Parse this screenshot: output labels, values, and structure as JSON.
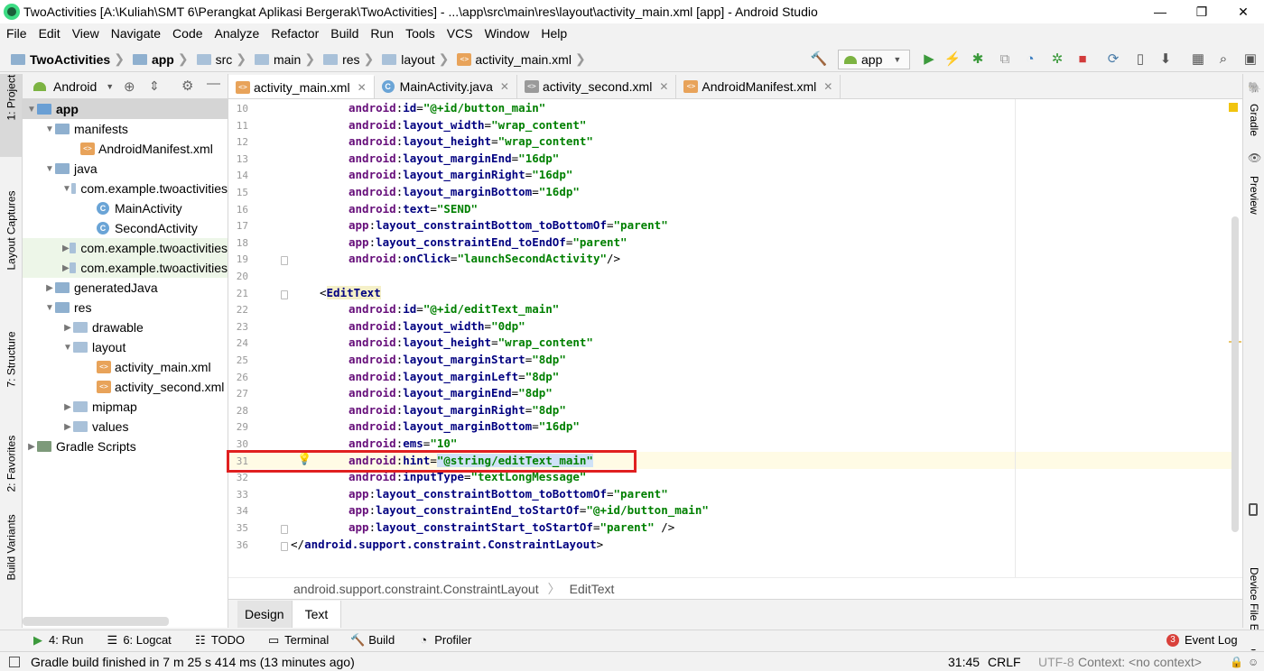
{
  "window": {
    "title": "TwoActivities [A:\\Kuliah\\SMT 6\\Perangkat Aplikasi Bergerak\\TwoActivities] - ...\\app\\src\\main\\res\\layout\\activity_main.xml [app] - Android Studio",
    "minimize": "—",
    "maximize": "❐",
    "close": "✕"
  },
  "menu": [
    "File",
    "Edit",
    "View",
    "Navigate",
    "Code",
    "Analyze",
    "Refactor",
    "Build",
    "Run",
    "Tools",
    "VCS",
    "Window",
    "Help"
  ],
  "breadcrumb": [
    "TwoActivities",
    "app",
    "src",
    "main",
    "res",
    "layout",
    "activity_main.xml"
  ],
  "toolbar": {
    "run_config": "app"
  },
  "left_tools": {
    "project": "1: Project",
    "captures": "Layout Captures",
    "structure": "7: Structure",
    "favorites": "2: Favorites",
    "variants": "Build Variants"
  },
  "project_panel": {
    "view_mode": "Android",
    "tree": [
      {
        "label": "app",
        "bold": true
      },
      {
        "label": "manifests"
      },
      {
        "label": "AndroidManifest.xml"
      },
      {
        "label": "java"
      },
      {
        "label": "com.example.twoactivities"
      },
      {
        "label": "MainActivity"
      },
      {
        "label": "SecondActivity"
      },
      {
        "label": "com.example.twoactivities"
      },
      {
        "label": "com.example.twoactivities"
      },
      {
        "label": "generatedJava"
      },
      {
        "label": "res"
      },
      {
        "label": "drawable"
      },
      {
        "label": "layout"
      },
      {
        "label": "activity_main.xml"
      },
      {
        "label": "activity_second.xml"
      },
      {
        "label": "mipmap"
      },
      {
        "label": "values"
      },
      {
        "label": "Gradle Scripts"
      }
    ]
  },
  "editor_tabs": [
    "activity_main.xml",
    "MainActivity.java",
    "activity_second.xml",
    "AndroidManifest.xml"
  ],
  "code_lines": [
    {
      "n": "10",
      "ns": "android",
      "attr": "id",
      "val": "\"@+id/button_main\""
    },
    {
      "n": "11",
      "ns": "android",
      "attr": "layout_width",
      "val": "\"wrap_content\""
    },
    {
      "n": "12",
      "ns": "android",
      "attr": "layout_height",
      "val": "\"wrap_content\""
    },
    {
      "n": "13",
      "ns": "android",
      "attr": "layout_marginEnd",
      "val": "\"16dp\""
    },
    {
      "n": "14",
      "ns": "android",
      "attr": "layout_marginRight",
      "val": "\"16dp\""
    },
    {
      "n": "15",
      "ns": "android",
      "attr": "layout_marginBottom",
      "val": "\"16dp\""
    },
    {
      "n": "16",
      "ns": "android",
      "attr": "text",
      "val": "\"SEND\""
    },
    {
      "n": "17",
      "ns": "app",
      "attr": "layout_constraintBottom_toBottomOf",
      "val": "\"parent\""
    },
    {
      "n": "18",
      "ns": "app",
      "attr": "layout_constraintEnd_toEndOf",
      "val": "\"parent\""
    },
    {
      "n": "19",
      "ns": "android",
      "attr": "onClick",
      "val": "\"launchSecondActivity\"",
      "tail": "/>"
    },
    {
      "n": "20"
    },
    {
      "n": "21",
      "open": "EditText"
    },
    {
      "n": "22",
      "ns": "android",
      "attr": "id",
      "val": "\"@+id/editText_main\""
    },
    {
      "n": "23",
      "ns": "android",
      "attr": "layout_width",
      "val": "\"0dp\""
    },
    {
      "n": "24",
      "ns": "android",
      "attr": "layout_height",
      "val": "\"wrap_content\""
    },
    {
      "n": "25",
      "ns": "android",
      "attr": "layout_marginStart",
      "val": "\"8dp\""
    },
    {
      "n": "26",
      "ns": "android",
      "attr": "layout_marginLeft",
      "val": "\"8dp\""
    },
    {
      "n": "27",
      "ns": "android",
      "attr": "layout_marginEnd",
      "val": "\"8dp\""
    },
    {
      "n": "28",
      "ns": "android",
      "attr": "layout_marginRight",
      "val": "\"8dp\""
    },
    {
      "n": "29",
      "ns": "android",
      "attr": "layout_marginBottom",
      "val": "\"16dp\""
    },
    {
      "n": "30",
      "ns": "android",
      "attr": "ems",
      "val": "\"10\""
    },
    {
      "n": "31",
      "ns": "android",
      "attr": "hint",
      "val": "\"@string/editText_main\""
    },
    {
      "n": "32",
      "ns": "android",
      "attr": "inputType",
      "val": "\"textLongMessage\""
    },
    {
      "n": "33",
      "ns": "app",
      "attr": "layout_constraintBottom_toBottomOf",
      "val": "\"parent\""
    },
    {
      "n": "34",
      "ns": "app",
      "attr": "layout_constraintEnd_toStartOf",
      "val": "\"@+id/button_main\""
    },
    {
      "n": "35",
      "ns": "app",
      "attr": "layout_constraintStart_toStartOf",
      "val": "\"parent\"",
      "tail": " />"
    },
    {
      "n": "36",
      "close": "android.support.constraint.ConstraintLayout"
    }
  ],
  "editor_breadcrumb": [
    "android.support.constraint.ConstraintLayout",
    "EditText"
  ],
  "design_tabs": [
    "Design",
    "Text"
  ],
  "right_tools": {
    "gradle": "Gradle",
    "preview": "Preview",
    "device_explorer": "Device File Explorer"
  },
  "bottom_tools": [
    "4: Run",
    "6: Logcat",
    "TODO",
    "Terminal",
    "Build",
    "Profiler"
  ],
  "event_log": {
    "count": "3",
    "label": "Event Log"
  },
  "status": {
    "message": "Gradle build finished in 7 m 25 s 414 ms (13 minutes ago)",
    "position": "31:45",
    "line_sep": "CRLF",
    "encoding": "UTF-8",
    "context": "Context: <no context>"
  },
  "colors": {
    "highlight_box": "#e02020",
    "attr": "#000080",
    "namespace": "#660e7a",
    "value": "#008000"
  }
}
